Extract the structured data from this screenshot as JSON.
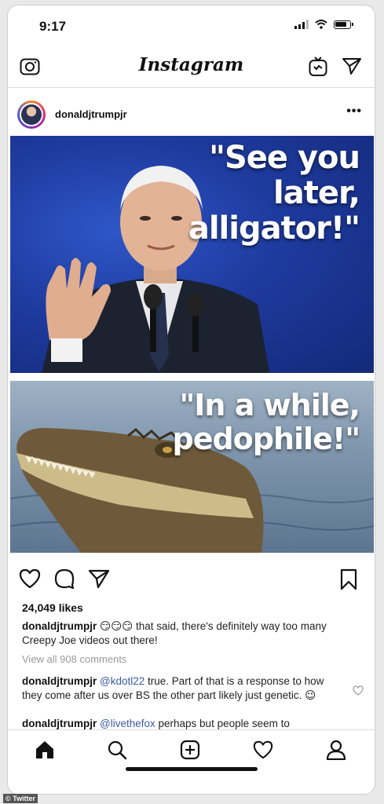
{
  "status_bar": {
    "time": "9:17"
  },
  "navbar": {
    "brand": "Instagram"
  },
  "post": {
    "username": "donaldjtrumpjr",
    "more": "•••",
    "image": {
      "top_quote": "\"See you\nlater,\nalligator!\"",
      "bottom_quote": "\"In a while,\npedophile!\""
    },
    "likes": "24,049 likes",
    "caption": {
      "username": "donaldjtrumpjr",
      "emojis": "😏😏😏",
      "text": " that said, there's definitely way too many Creepy Joe videos out there!"
    },
    "view_all": "View all 908 comments",
    "comments": [
      {
        "username": "donaldjtrumpjr",
        "mention": "@kdotl22",
        "text": " true. Part of that is a response to how they come after us over BS the other part likely just genetic. 😉"
      },
      {
        "username": "donaldjtrumpjr",
        "mention": "@livethefox",
        "text": " perhaps but people seem to"
      }
    ]
  },
  "watermark": "© Twitter",
  "icons": {
    "camera": "camera-icon",
    "igtv": "igtv-icon",
    "send": "direct-message-icon",
    "heart": "heart-icon",
    "comment": "comment-icon",
    "share": "share-icon",
    "bookmark": "bookmark-icon",
    "home": "home-icon",
    "search": "search-icon",
    "add": "add-post-icon",
    "activity": "activity-heart-icon",
    "profile": "profile-icon"
  },
  "colors": {
    "link": "#3b5aa0",
    "muted": "#999999",
    "panel_blue": "#1e3a9e"
  }
}
